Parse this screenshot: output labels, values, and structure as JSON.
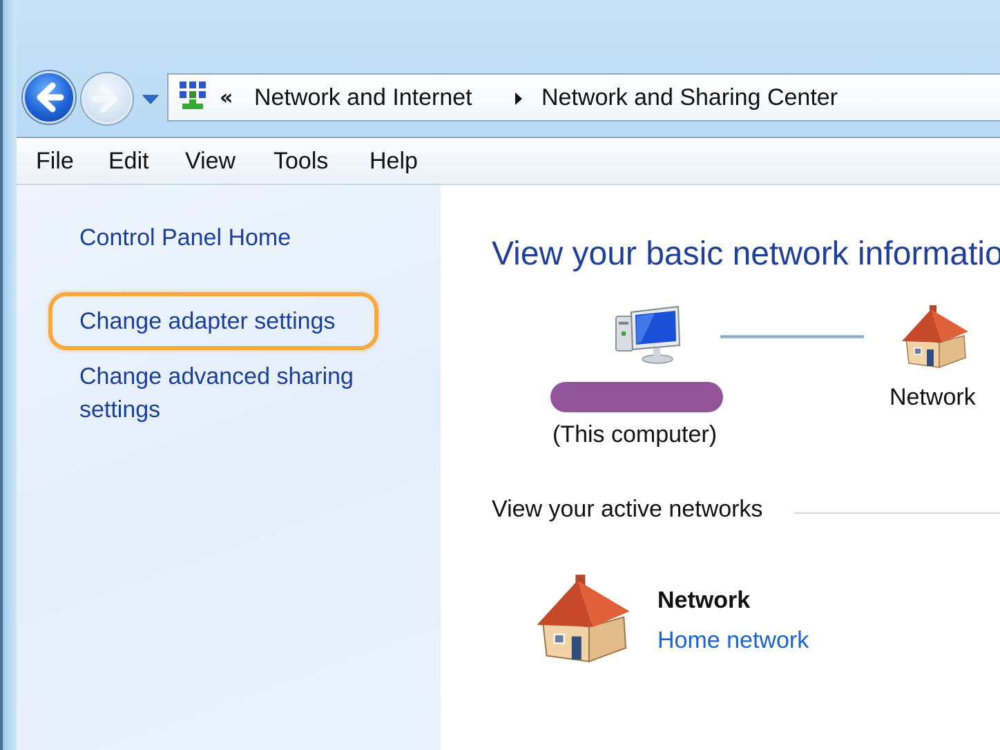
{
  "address_bar": {
    "overflow_chevron": "«",
    "crumbs": [
      "Network and Internet",
      "Network and Sharing Center"
    ]
  },
  "menu": [
    "File",
    "Edit",
    "View",
    "Tools",
    "Help"
  ],
  "sidebar": {
    "home": "Control Panel Home",
    "adapter": "Change adapter settings",
    "advanced_line1": "Change advanced sharing",
    "advanced_line2": "settings"
  },
  "main": {
    "heading": "View your basic network informatio",
    "this_computer": "(This computer)",
    "network_label": "Network",
    "active_title": "View your active networks",
    "active_network": {
      "name": "Network",
      "type": "Home network"
    }
  },
  "icons": {
    "back": "back-arrow-icon",
    "forward": "forward-arrow-icon",
    "recent": "chevron-down-icon",
    "control_panel": "control-panel-icon",
    "computer": "computer-icon",
    "house": "house-icon"
  },
  "colors": {
    "link": "#1a3e9c",
    "heading": "#1e3f9a",
    "highlight": "#f7a940",
    "redaction": "#92559a",
    "home_network_link": "#1a64d2"
  }
}
